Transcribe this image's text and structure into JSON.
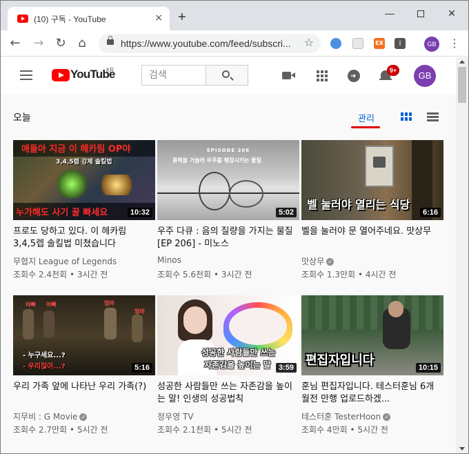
{
  "browser": {
    "tab_title": "(10) 구독 - YouTube",
    "tab_close": "×",
    "new_tab": "+",
    "url": "https://www.youtube.com/feed/subscri...",
    "profile_initials": "GB",
    "ext_ex_label": "EX",
    "ext_i_label": "i",
    "window_min": "—",
    "window_close": "✕"
  },
  "header": {
    "logo_text": "YouTube",
    "logo_region": "KR",
    "search_placeholder": "검색",
    "notification_count": "9+",
    "avatar_initials": "GB"
  },
  "feed": {
    "section_title": "오늘",
    "manage_label": "관리",
    "videos": [
      {
        "title": "프로도 당하고 있다. 이 헤카림 3,4,5렙 솔킬법 미쳤습니다",
        "channel": "무협지 League of Legends",
        "verified": false,
        "views": "조회수 2.4천회",
        "time": "3시간 전",
        "duration": "10:32",
        "thumb_top": "애들아 지금 이 헤카림 OP야",
        "thumb_mid": "3,4,5렙 강제 솔킬법",
        "thumb_bottom": "누가해도 사기 꿀 빠세요"
      },
      {
        "title": "우주 다큐 : 음의 질량을 가지는 물질 [EP 206] - 미노스",
        "channel": "Minos",
        "verified": false,
        "views": "조회수 5.6천회",
        "time": "3시간 전",
        "duration": "5:02",
        "thumb_top": "EPISODE 206",
        "thumb_mid": "중력을 거슬러 우주를 팽창시키는 물질"
      },
      {
        "title": "벨을 눌러야 문 열어주네요. 맛상무",
        "channel": "맛상무",
        "verified": true,
        "views": "조회수 1.3만회",
        "time": "4시간 전",
        "duration": "6:16",
        "thumb_bottom": "벨 눌러야 열리는 식당"
      },
      {
        "title": "우리 가족 앞에 나타난 우리 가족(?)",
        "channel": "지무비 : G Movie",
        "verified": true,
        "views": "조회수 2.7만회",
        "time": "5시간 전",
        "duration": "5:16",
        "thumb_labels": [
          "아빠",
          "아빠",
          "엄마",
          "엄마"
        ],
        "thumb_sub1": "- 누구세요...?",
        "thumb_sub2": "- 우리잖아...?"
      },
      {
        "title": "성공한 사람들만 쓰는 자존감을 높이는 말! 인생의 성공법칙",
        "channel": "정우영 TV",
        "verified": false,
        "views": "조회수 2.1천회",
        "time": "5시간 전",
        "duration": "3:59",
        "thumb_line1": "성공한 사람들만 쓰는",
        "thumb_line2": "자존감을 높이는 말"
      },
      {
        "title": "훈님 편집자입니다. 테스터훈님 6개월전 만행 업로드하겠...",
        "channel": "테스터훈 TesterHoon",
        "verified": true,
        "views": "조회수 4만회",
        "time": "5시간 전",
        "duration": "10:15",
        "thumb_bottom": "편집자입니다"
      }
    ]
  },
  "separator": "•",
  "check_glyph": "✓"
}
